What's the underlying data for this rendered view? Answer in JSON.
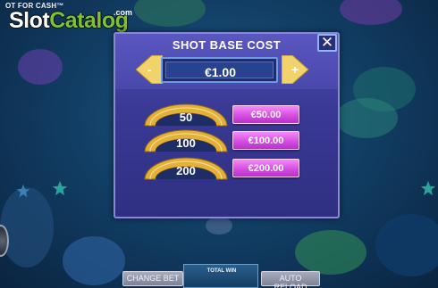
{
  "brand": {
    "tagline": "OT FOR CASH™",
    "logo_part1": "Slot",
    "logo_part2": "Catalog",
    "domain": ".com"
  },
  "modal": {
    "title": "SHOT BASE COST",
    "current_cost": "€1.00",
    "decrease_icon": "minus-icon",
    "increase_icon": "plus-icon",
    "decrease_label": "-",
    "increase_label": "+",
    "close_icon": "close-icon",
    "close_label": "✕",
    "options": [
      {
        "shots": "50",
        "price": "€50.00"
      },
      {
        "shots": "100",
        "price": "€100.00"
      },
      {
        "shots": "200",
        "price": "€200.00"
      }
    ]
  },
  "bottom_bar": {
    "change_bet": "CHANGE BET",
    "total_win": "TOTAL WIN",
    "auto_reload": "AUTO RELOAD"
  },
  "colors": {
    "modal_bg": "#3a3a96",
    "price_button": "#d64de3",
    "gauge_gold": "#e3b13a",
    "arrow_yellow": "#f2d36b",
    "logo_green": "#79c23a"
  }
}
